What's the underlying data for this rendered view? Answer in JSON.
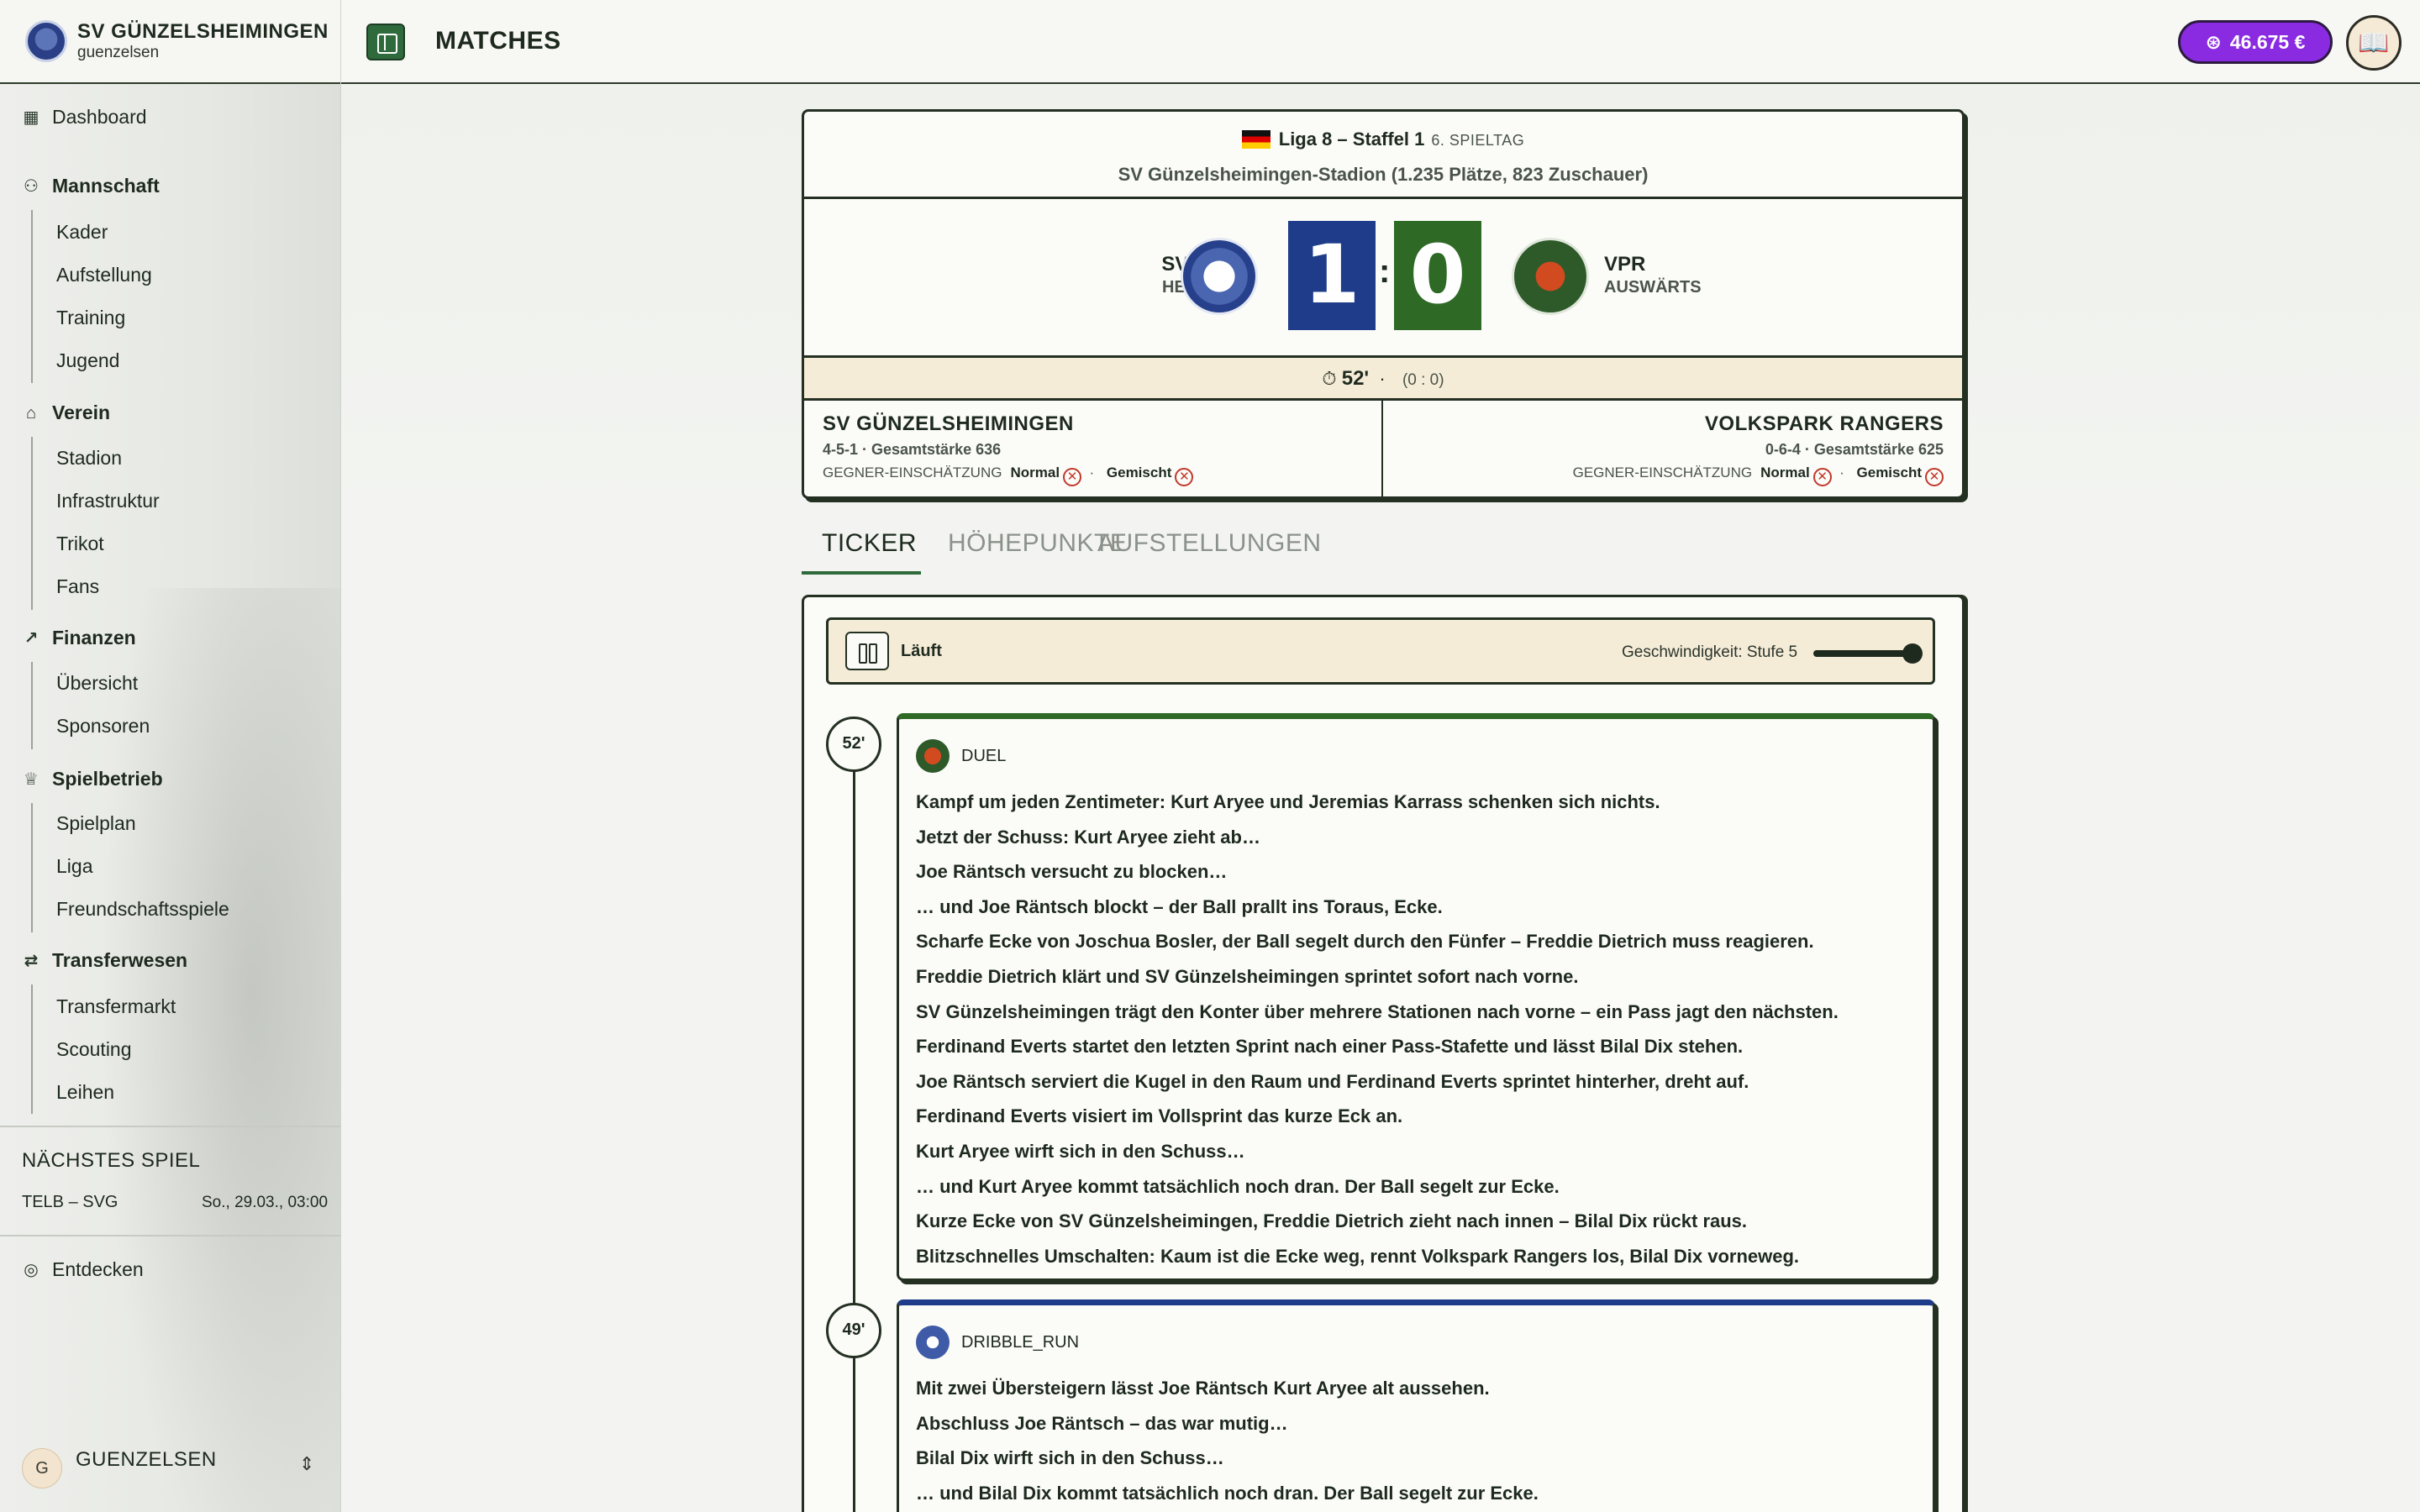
{
  "club": {
    "name": "SV GÜNZELSHEIMINGEN",
    "user": "guenzelsen"
  },
  "nav": {
    "dashboard": "Dashboard",
    "mannschaft": "Mannschaft",
    "kader": "Kader",
    "aufstellung": "Aufstellung",
    "training": "Training",
    "jugend": "Jugend",
    "verein": "Verein",
    "stadion": "Stadion",
    "infrastruktur": "Infrastruktur",
    "trikot": "Trikot",
    "fans": "Fans",
    "finanzen": "Finanzen",
    "uebersicht": "Übersicht",
    "sponsoren": "Sponsoren",
    "spielbetrieb": "Spielbetrieb",
    "spielplan": "Spielplan",
    "liga": "Liga",
    "freundschaftsspiele": "Freundschaftsspiele",
    "transferwesen": "Transferwesen",
    "transfermarkt": "Transfermarkt",
    "scouting": "Scouting",
    "leihen": "Leihen",
    "entdecken": "Entdecken"
  },
  "next_match": {
    "title": "NÄCHSTES SPIEL",
    "teams": "TELB – SVG",
    "date": "So., 29.03., 03:00"
  },
  "user": {
    "initial": "G",
    "name": "GUENZELSEN"
  },
  "topbar": {
    "title": "MATCHES",
    "balance": "46.675 €"
  },
  "match": {
    "league": "Liga 8 – Staffel 1",
    "matchday": "6. SPIELTAG",
    "stadium": "SV Günzelsheimingen-Stadion (1.235 Plätze, 823 Zuschauer)",
    "home": {
      "abbr": "SVG",
      "role": "HEIM",
      "score": "1",
      "name": "SV GÜNZELSHEIMINGEN",
      "form": "4-5-1 · Gesamtstärke 636"
    },
    "away": {
      "abbr": "VPR",
      "role": "AUSWÄRTS",
      "score": "0",
      "name": "VOLKSPARK RANGERS",
      "form": "0-6-4 · Gesamtstärke 625"
    },
    "minute": "52'",
    "halftime": "(0 : 0)",
    "rating_label": "GEGNER-EINSCHÄTZUNG",
    "rating_1": "Normal",
    "rating_2": "Gemischt"
  },
  "tabs": {
    "ticker": "TICKER",
    "highlights": "HÖHEPUNKTE",
    "lineups": "AUFSTELLUNGEN"
  },
  "ticker": {
    "status": "Läuft",
    "speed": "Geschwindigkeit: Stufe 5",
    "speed_level": 5,
    "events": [
      {
        "minute": "52'",
        "type": "DUEL",
        "lines": [
          "Kampf um jeden Zentimeter: Kurt Aryee und Jeremias Karrass schenken sich nichts.",
          "Jetzt der Schuss: Kurt Aryee zieht ab…",
          "Joe Räntsch versucht zu blocken…",
          "… und Joe Räntsch blockt – der Ball prallt ins Toraus, Ecke.",
          "Scharfe Ecke von Joschua Bosler, der Ball segelt durch den Fünfer – Freddie Dietrich muss reagieren.",
          "Freddie Dietrich klärt und SV Günzelsheimingen sprintet sofort nach vorne.",
          "SV Günzelsheimingen trägt den Konter über mehrere Stationen nach vorne – ein Pass jagt den nächsten.",
          "Ferdinand Everts startet den letzten Sprint nach einer Pass-Stafette und lässt Bilal Dix stehen.",
          "Joe Räntsch serviert die Kugel in den Raum und Ferdinand Everts sprintet hinterher, dreht auf.",
          "Ferdinand Everts visiert im Vollsprint das kurze Eck an.",
          "Kurt Aryee wirft sich in den Schuss…",
          "… und Kurt Aryee kommt tatsächlich noch dran. Der Ball segelt zur Ecke.",
          "Kurze Ecke von SV Günzelsheimingen, Freddie Dietrich zieht nach innen – Bilal Dix rückt raus.",
          "Blitzschnelles Umschalten: Kaum ist die Ecke weg, rennt Volkspark Rangers los, Bilal Dix vorneweg."
        ]
      },
      {
        "minute": "49'",
        "type": "DRIBBLE_RUN",
        "lines": [
          "Mit zwei Übersteigern lässt Joe Räntsch Kurt Aryee alt aussehen.",
          "Abschluss Joe Räntsch – das war mutig…",
          "Bilal Dix wirft sich in den Schuss…",
          "… und Bilal Dix kommt tatsächlich noch dran. Der Ball segelt zur Ecke."
        ]
      }
    ]
  }
}
